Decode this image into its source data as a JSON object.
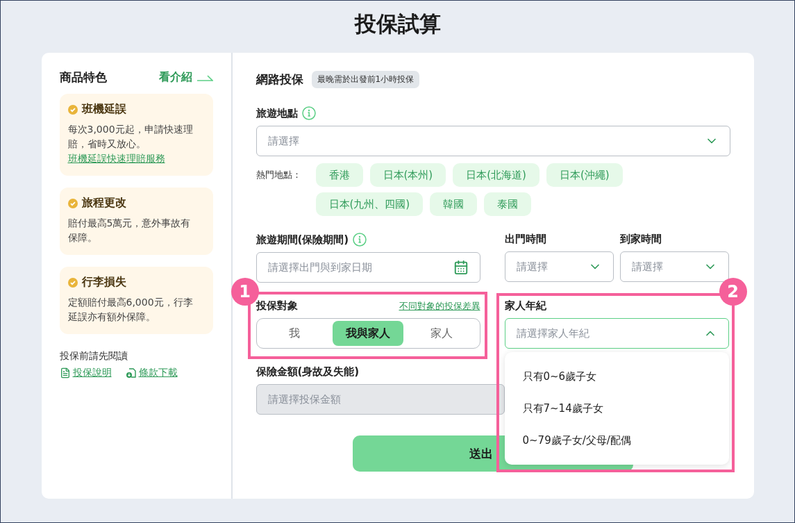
{
  "page_title": "投保試算",
  "features": {
    "title": "商品特色",
    "intro_link": "看介紹",
    "items": [
      {
        "title": "班機延誤",
        "text": "每次3,000元起，申請快速理賠，省時又放心。",
        "link": "班機延誤快速理賠服務"
      },
      {
        "title": "旅程更改",
        "text": "賠付最高5萬元，意外事故有保障。"
      },
      {
        "title": "行李損失",
        "text": "定額賠付最高6,000元，行李延誤亦有額外保障。"
      }
    ]
  },
  "read_first": {
    "label": "投保前請先閱讀",
    "links": [
      {
        "kind": "document",
        "label": "投保說明"
      },
      {
        "kind": "download",
        "label": "條款下載"
      }
    ]
  },
  "online": {
    "title": "網路投保",
    "badge": "最晚需於出發前1小時投保"
  },
  "destination": {
    "label": "旅遊地點",
    "placeholder": "請選擇",
    "popular_label": "熱門地點：",
    "popular": [
      "香港",
      "日本(本州)",
      "日本(北海道)",
      "日本(沖繩)",
      "日本(九州、四國)",
      "韓國",
      "泰國"
    ]
  },
  "period": {
    "label": "旅遊期間(保險期間)",
    "placeholder": "請選擇出門與到家日期"
  },
  "depart_time": {
    "label": "出門時間",
    "placeholder": "請選擇"
  },
  "return_time": {
    "label": "到家時間",
    "placeholder": "請選擇"
  },
  "insured": {
    "label": "投保對象",
    "link": "不同對象的投保差異",
    "options": [
      {
        "label": "我",
        "selected": false
      },
      {
        "label": "我與家人",
        "selected": true
      },
      {
        "label": "家人",
        "selected": false
      }
    ]
  },
  "family_age": {
    "label": "家人年紀",
    "placeholder": "請選擇家人年紀",
    "expanded": true,
    "options": [
      "只有0~6歲子女",
      "只有7~14歲子女",
      "0~79歲子女/父母/配偶"
    ]
  },
  "amount": {
    "label": "保險金額(身故及失能)",
    "placeholder": "請選擇投保金額",
    "disabled": true
  },
  "submit": "送出",
  "callouts": [
    "1",
    "2"
  ]
}
